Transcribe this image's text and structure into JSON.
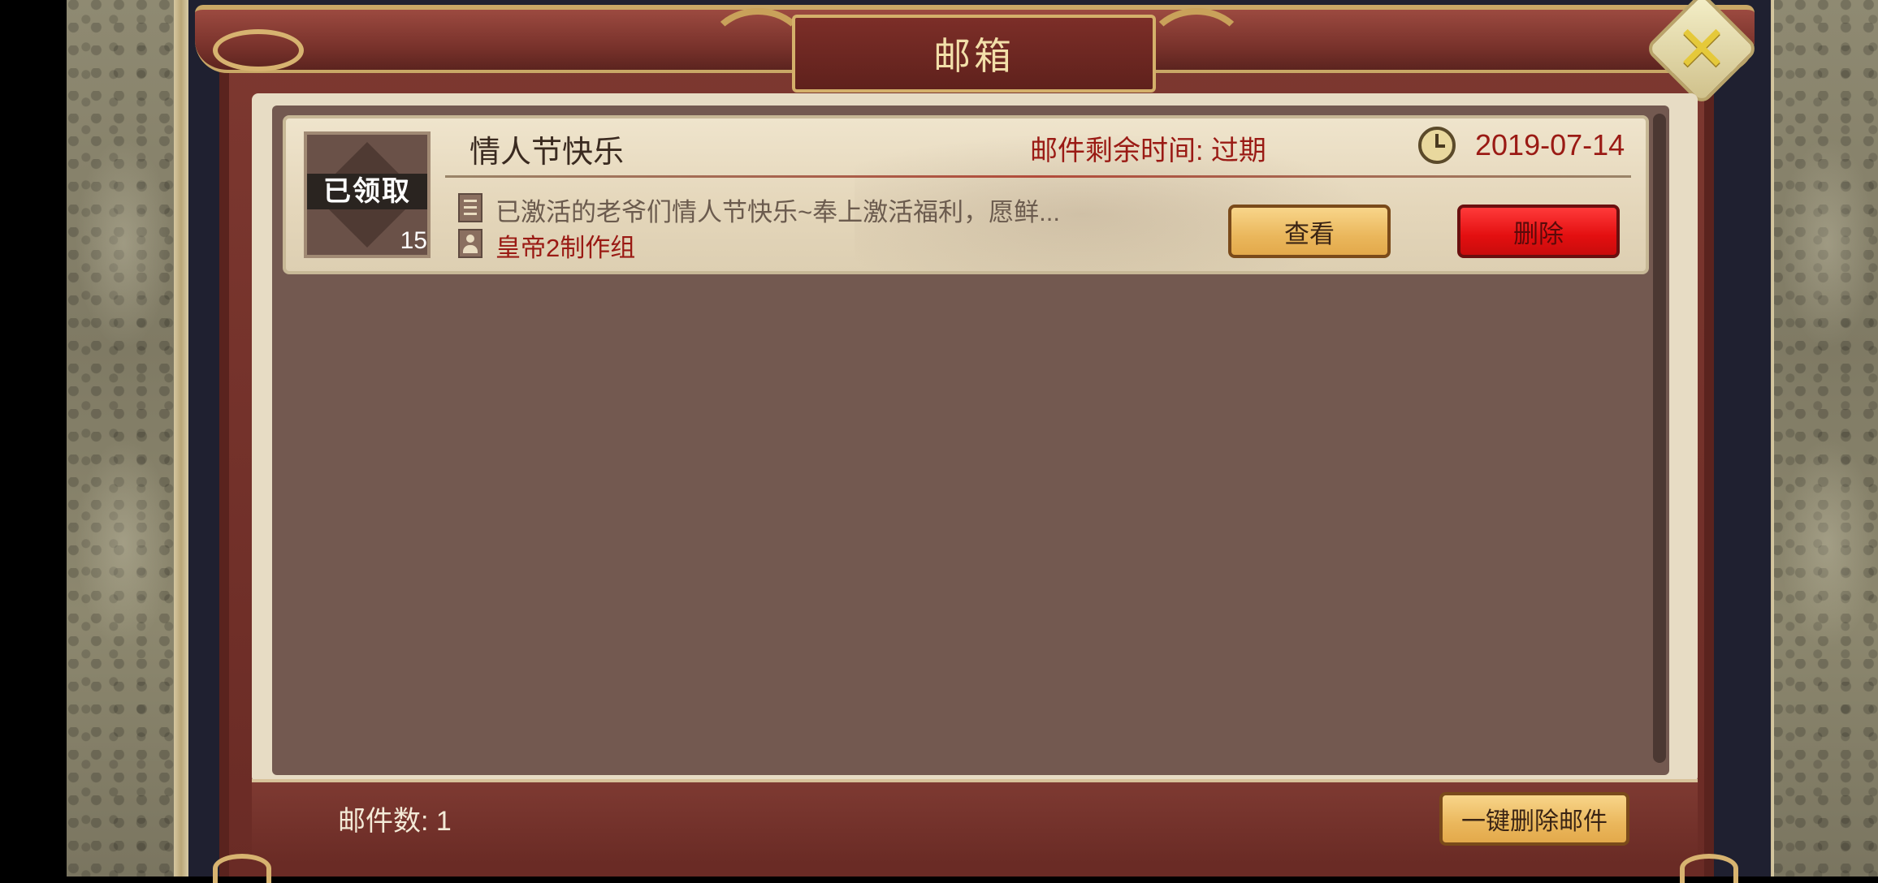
{
  "dialog": {
    "title": "邮箱",
    "close_icon": "close-icon"
  },
  "mails": [
    {
      "icon_stamp": "已领取",
      "icon_count": "15",
      "title": "情人节快乐",
      "expire_label": "邮件剩余时间:",
      "expire_value": "过期",
      "date": "2019-07-14",
      "preview": "已激活的老爷们情人节快乐~奉上激活福利，愿鲜...",
      "sender": "皇帝2制作组",
      "view_label": "查看",
      "delete_label": "删除"
    }
  ],
  "footer": {
    "count_label": "邮件数:",
    "count_value": "1",
    "delete_all_label": "一键删除邮件"
  },
  "colors": {
    "frame": "#7a332c",
    "accent_gold": "#d4b06a",
    "delete_red": "#e30f10",
    "view_gold": "#eab75c",
    "red_text": "#9a1a14"
  }
}
